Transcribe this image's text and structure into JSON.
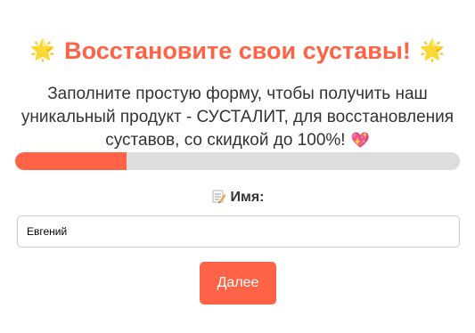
{
  "header": {
    "title": "Восстановите свои суставы!",
    "left_emoji": "🌟",
    "right_emoji": "🌟"
  },
  "intro": {
    "text": "Заполните простую форму, чтобы получить наш уникальный продукт - СУСТАЛИТ, для восстановления суставов, со скидкой до 100%!",
    "emoji": "💖"
  },
  "progress": {
    "fraction": 0.25
  },
  "form": {
    "label": "Имя:",
    "label_icon": "memo-icon",
    "name_value": "Евгений"
  },
  "actions": {
    "next_label": "Далее"
  },
  "colors": {
    "accent": "#ff6347",
    "track": "#dddddd",
    "text": "#333333"
  }
}
